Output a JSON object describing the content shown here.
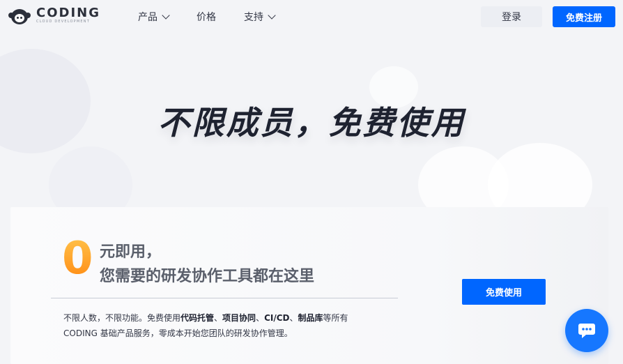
{
  "header": {
    "logo_name": "CODING",
    "logo_sub": "CLOUD DEVELOPMENT",
    "nav": [
      {
        "label": "产品",
        "has_dropdown": true
      },
      {
        "label": "价格",
        "has_dropdown": false
      },
      {
        "label": "支持",
        "has_dropdown": true
      }
    ],
    "login_label": "登录",
    "register_label": "免费注册"
  },
  "hero": {
    "title": "不限成员，免费使用"
  },
  "card": {
    "zero": "0",
    "slogan_line1": "元即用，",
    "slogan_line2": "您需要的研发协作工具都在这里",
    "desc_parts": [
      "不限人数，不限功能。免费使用",
      "代码托管",
      "、",
      "项目协同",
      "、",
      "CI/CD",
      "、",
      "制品库",
      "等所有",
      "CODING 基础产品服务，零成本开始您团队的研发协作管理。"
    ],
    "cta_label": "免费使用"
  },
  "colors": {
    "primary": "#0066ff",
    "accent_orange": "#ff9a1f",
    "text_dark": "#1e2230"
  },
  "icons": {
    "logo": "monkey-logo-icon",
    "chat": "chat-bubble-icon",
    "dropdown": "chevron-down-icon"
  }
}
